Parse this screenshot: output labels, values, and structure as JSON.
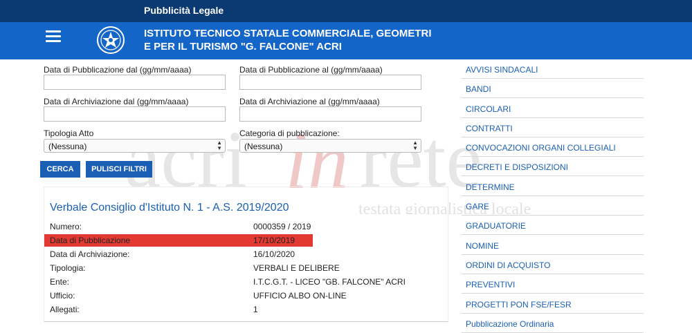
{
  "topbar": {
    "label": "Pubblicità Legale"
  },
  "header": {
    "title_line1": "ISTITUTO TECNICO STATALE COMMERCIALE, GEOMETRI",
    "title_line2": "E PER IL TURISMO \"G. FALCONE\" ACRI"
  },
  "filters": {
    "pub_from_label": "Data di Pubblicazione dal (gg/mm/aaaa)",
    "pub_to_label": "Data di Pubblicazione al (gg/mm/aaaa)",
    "arch_from_label": "Data di Archiviazione dal (gg/mm/aaaa)",
    "arch_to_label": "Data di Archiviazione al (gg/mm/aaaa)",
    "tipologia_label": "Tipologia Atto",
    "tipologia_value": "(Nessuna)",
    "categoria_label": "Categoria di pubblicazione:",
    "categoria_value": "(Nessuna)",
    "search_button": "CERCA",
    "clear_button": "PULISCI FILTRI"
  },
  "record": {
    "title": "Verbale Consiglio d'Istituto N. 1 - A.S. 2019/2020",
    "rows": [
      {
        "label": "Numero:",
        "value": "0000359 / 2019"
      },
      {
        "label": "Data di Pubblicazione",
        "value": "17/10/2019"
      },
      {
        "label": "Data di Archiviazione:",
        "value": "16/10/2020"
      },
      {
        "label": "Tipologia:",
        "value": "VERBALI E DELIBERE"
      },
      {
        "label": "Ente:",
        "value": "I.T.C.G.T. - LICEO \"GB. FALCONE\" ACRI"
      },
      {
        "label": "Ufficio:",
        "value": "UFFICIO ALBO ON-LINE"
      },
      {
        "label": "Allegati:",
        "value": "1"
      }
    ]
  },
  "sidebar": {
    "items": [
      "AVVISI SINDACALI",
      "BANDI",
      "CIRCOLARI",
      "CONTRATTI",
      "CONVOCAZIONI ORGANI COLLEGIALI",
      "DECRETI E DISPOSIZIONI",
      "DETERMINE",
      "GARE",
      "GRADUATORIE",
      "NOMINE",
      "ORDINI DI ACQUISTO",
      "PREVENTIVI",
      "PROGETTI PON FSE/FESR",
      "Pubblicazione Ordinaria"
    ]
  },
  "watermark": {
    "brand_left": "acri",
    "brand_mid": "in",
    "brand_right": "rete",
    "tagline": "testata giornalistica locale"
  },
  "colors": {
    "topbar": "#0b3a72",
    "header": "#1366c8",
    "accent": "#1a5fb4",
    "highlight": "#e23a33"
  },
  "icons": {
    "menu": "hamburger-menu-icon",
    "emblem": "italian-republic-emblem-icon",
    "select_arrow": "updown-arrow-icon"
  }
}
